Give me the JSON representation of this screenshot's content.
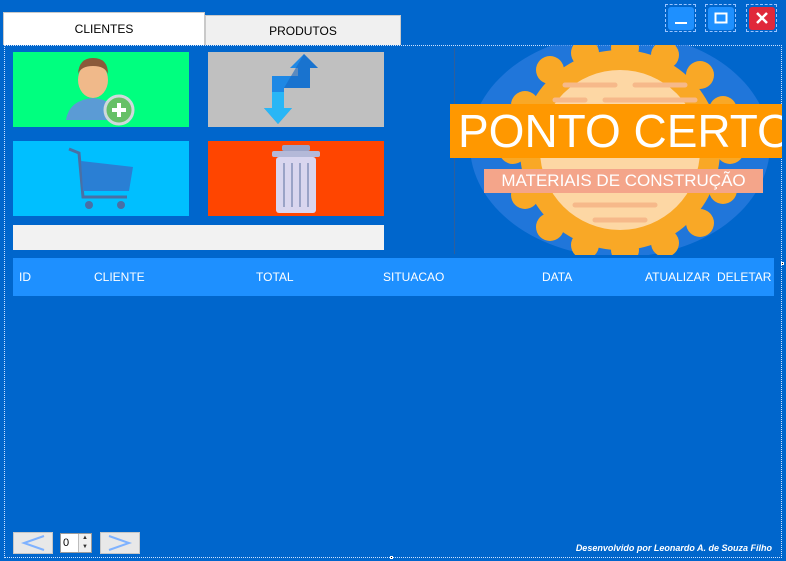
{
  "tabs": [
    {
      "label": "CLIENTES",
      "active": true
    },
    {
      "label": "PRODUTOS",
      "active": false
    }
  ],
  "window_controls": {
    "minimize_icon": "minimize-icon",
    "maximize_icon": "maximize-icon",
    "close_icon": "close-icon"
  },
  "tiles": [
    {
      "name": "add-client",
      "icon": "user-add-icon",
      "color": "#00ff7f"
    },
    {
      "name": "swap",
      "icon": "swap-arrows-icon",
      "color": "#c0c0c0"
    },
    {
      "name": "cart",
      "icon": "shopping-cart-icon",
      "color": "#00bfff"
    },
    {
      "name": "delete",
      "icon": "trash-icon",
      "color": "#ff4500"
    }
  ],
  "search": {
    "value": ""
  },
  "brand": {
    "title": "PONTO CERTO",
    "subtitle": "MATERIAIS DE CONSTRUÇÃO"
  },
  "grid": {
    "columns": [
      "ID",
      "CLIENTE",
      "TOTAL",
      "SITUACAO",
      "DATA",
      "ATUALIZAR",
      "DELETAR"
    ],
    "rows": []
  },
  "pagination": {
    "page": "0"
  },
  "footer": {
    "credit": "Desenvolvido por Leonardo A. de Souza Filho"
  },
  "colors": {
    "background": "#0066cc",
    "header": "#1e90ff",
    "brand_orange": "#ff9800",
    "brand_salmon": "#f4a58a"
  }
}
